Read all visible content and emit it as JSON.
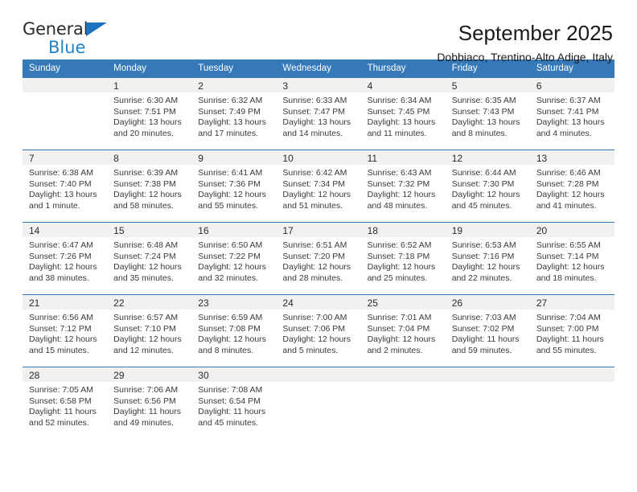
{
  "logo": {
    "part1": "General",
    "part2": "Blue",
    "triangle_color": "#1f72bd",
    "blue_color": "#2383c7"
  },
  "header": {
    "title": "September 2025",
    "subtitle": "Dobbiaco, Trentino-Alto Adige, Italy"
  },
  "colors": {
    "header_bar": "#3579b8",
    "daynum_band": "#f1f1f1",
    "text": "#333333"
  },
  "weekday_headers": [
    "Sunday",
    "Monday",
    "Tuesday",
    "Wednesday",
    "Thursday",
    "Friday",
    "Saturday"
  ],
  "weeks": [
    [
      {
        "day": "",
        "sunrise": "",
        "sunset": "",
        "daylight_line1": "",
        "daylight_line2": "",
        "empty": true
      },
      {
        "day": "1",
        "sunrise": "Sunrise: 6:30 AM",
        "sunset": "Sunset: 7:51 PM",
        "daylight_line1": "Daylight: 13 hours",
        "daylight_line2": "and 20 minutes."
      },
      {
        "day": "2",
        "sunrise": "Sunrise: 6:32 AM",
        "sunset": "Sunset: 7:49 PM",
        "daylight_line1": "Daylight: 13 hours",
        "daylight_line2": "and 17 minutes."
      },
      {
        "day": "3",
        "sunrise": "Sunrise: 6:33 AM",
        "sunset": "Sunset: 7:47 PM",
        "daylight_line1": "Daylight: 13 hours",
        "daylight_line2": "and 14 minutes."
      },
      {
        "day": "4",
        "sunrise": "Sunrise: 6:34 AM",
        "sunset": "Sunset: 7:45 PM",
        "daylight_line1": "Daylight: 13 hours",
        "daylight_line2": "and 11 minutes."
      },
      {
        "day": "5",
        "sunrise": "Sunrise: 6:35 AM",
        "sunset": "Sunset: 7:43 PM",
        "daylight_line1": "Daylight: 13 hours",
        "daylight_line2": "and 8 minutes."
      },
      {
        "day": "6",
        "sunrise": "Sunrise: 6:37 AM",
        "sunset": "Sunset: 7:41 PM",
        "daylight_line1": "Daylight: 13 hours",
        "daylight_line2": "and 4 minutes."
      }
    ],
    [
      {
        "day": "7",
        "sunrise": "Sunrise: 6:38 AM",
        "sunset": "Sunset: 7:40 PM",
        "daylight_line1": "Daylight: 13 hours",
        "daylight_line2": "and 1 minute."
      },
      {
        "day": "8",
        "sunrise": "Sunrise: 6:39 AM",
        "sunset": "Sunset: 7:38 PM",
        "daylight_line1": "Daylight: 12 hours",
        "daylight_line2": "and 58 minutes."
      },
      {
        "day": "9",
        "sunrise": "Sunrise: 6:41 AM",
        "sunset": "Sunset: 7:36 PM",
        "daylight_line1": "Daylight: 12 hours",
        "daylight_line2": "and 55 minutes."
      },
      {
        "day": "10",
        "sunrise": "Sunrise: 6:42 AM",
        "sunset": "Sunset: 7:34 PM",
        "daylight_line1": "Daylight: 12 hours",
        "daylight_line2": "and 51 minutes."
      },
      {
        "day": "11",
        "sunrise": "Sunrise: 6:43 AM",
        "sunset": "Sunset: 7:32 PM",
        "daylight_line1": "Daylight: 12 hours",
        "daylight_line2": "and 48 minutes."
      },
      {
        "day": "12",
        "sunrise": "Sunrise: 6:44 AM",
        "sunset": "Sunset: 7:30 PM",
        "daylight_line1": "Daylight: 12 hours",
        "daylight_line2": "and 45 minutes."
      },
      {
        "day": "13",
        "sunrise": "Sunrise: 6:46 AM",
        "sunset": "Sunset: 7:28 PM",
        "daylight_line1": "Daylight: 12 hours",
        "daylight_line2": "and 41 minutes."
      }
    ],
    [
      {
        "day": "14",
        "sunrise": "Sunrise: 6:47 AM",
        "sunset": "Sunset: 7:26 PM",
        "daylight_line1": "Daylight: 12 hours",
        "daylight_line2": "and 38 minutes."
      },
      {
        "day": "15",
        "sunrise": "Sunrise: 6:48 AM",
        "sunset": "Sunset: 7:24 PM",
        "daylight_line1": "Daylight: 12 hours",
        "daylight_line2": "and 35 minutes."
      },
      {
        "day": "16",
        "sunrise": "Sunrise: 6:50 AM",
        "sunset": "Sunset: 7:22 PM",
        "daylight_line1": "Daylight: 12 hours",
        "daylight_line2": "and 32 minutes."
      },
      {
        "day": "17",
        "sunrise": "Sunrise: 6:51 AM",
        "sunset": "Sunset: 7:20 PM",
        "daylight_line1": "Daylight: 12 hours",
        "daylight_line2": "and 28 minutes."
      },
      {
        "day": "18",
        "sunrise": "Sunrise: 6:52 AM",
        "sunset": "Sunset: 7:18 PM",
        "daylight_line1": "Daylight: 12 hours",
        "daylight_line2": "and 25 minutes."
      },
      {
        "day": "19",
        "sunrise": "Sunrise: 6:53 AM",
        "sunset": "Sunset: 7:16 PM",
        "daylight_line1": "Daylight: 12 hours",
        "daylight_line2": "and 22 minutes."
      },
      {
        "day": "20",
        "sunrise": "Sunrise: 6:55 AM",
        "sunset": "Sunset: 7:14 PM",
        "daylight_line1": "Daylight: 12 hours",
        "daylight_line2": "and 18 minutes."
      }
    ],
    [
      {
        "day": "21",
        "sunrise": "Sunrise: 6:56 AM",
        "sunset": "Sunset: 7:12 PM",
        "daylight_line1": "Daylight: 12 hours",
        "daylight_line2": "and 15 minutes."
      },
      {
        "day": "22",
        "sunrise": "Sunrise: 6:57 AM",
        "sunset": "Sunset: 7:10 PM",
        "daylight_line1": "Daylight: 12 hours",
        "daylight_line2": "and 12 minutes."
      },
      {
        "day": "23",
        "sunrise": "Sunrise: 6:59 AM",
        "sunset": "Sunset: 7:08 PM",
        "daylight_line1": "Daylight: 12 hours",
        "daylight_line2": "and 8 minutes."
      },
      {
        "day": "24",
        "sunrise": "Sunrise: 7:00 AM",
        "sunset": "Sunset: 7:06 PM",
        "daylight_line1": "Daylight: 12 hours",
        "daylight_line2": "and 5 minutes."
      },
      {
        "day": "25",
        "sunrise": "Sunrise: 7:01 AM",
        "sunset": "Sunset: 7:04 PM",
        "daylight_line1": "Daylight: 12 hours",
        "daylight_line2": "and 2 minutes."
      },
      {
        "day": "26",
        "sunrise": "Sunrise: 7:03 AM",
        "sunset": "Sunset: 7:02 PM",
        "daylight_line1": "Daylight: 11 hours",
        "daylight_line2": "and 59 minutes."
      },
      {
        "day": "27",
        "sunrise": "Sunrise: 7:04 AM",
        "sunset": "Sunset: 7:00 PM",
        "daylight_line1": "Daylight: 11 hours",
        "daylight_line2": "and 55 minutes."
      }
    ],
    [
      {
        "day": "28",
        "sunrise": "Sunrise: 7:05 AM",
        "sunset": "Sunset: 6:58 PM",
        "daylight_line1": "Daylight: 11 hours",
        "daylight_line2": "and 52 minutes."
      },
      {
        "day": "29",
        "sunrise": "Sunrise: 7:06 AM",
        "sunset": "Sunset: 6:56 PM",
        "daylight_line1": "Daylight: 11 hours",
        "daylight_line2": "and 49 minutes."
      },
      {
        "day": "30",
        "sunrise": "Sunrise: 7:08 AM",
        "sunset": "Sunset: 6:54 PM",
        "daylight_line1": "Daylight: 11 hours",
        "daylight_line2": "and 45 minutes."
      },
      {
        "day": "",
        "sunrise": "",
        "sunset": "",
        "daylight_line1": "",
        "daylight_line2": "",
        "empty": true
      },
      {
        "day": "",
        "sunrise": "",
        "sunset": "",
        "daylight_line1": "",
        "daylight_line2": "",
        "empty": true
      },
      {
        "day": "",
        "sunrise": "",
        "sunset": "",
        "daylight_line1": "",
        "daylight_line2": "",
        "empty": true
      },
      {
        "day": "",
        "sunrise": "",
        "sunset": "",
        "daylight_line1": "",
        "daylight_line2": "",
        "empty": true
      }
    ]
  ]
}
